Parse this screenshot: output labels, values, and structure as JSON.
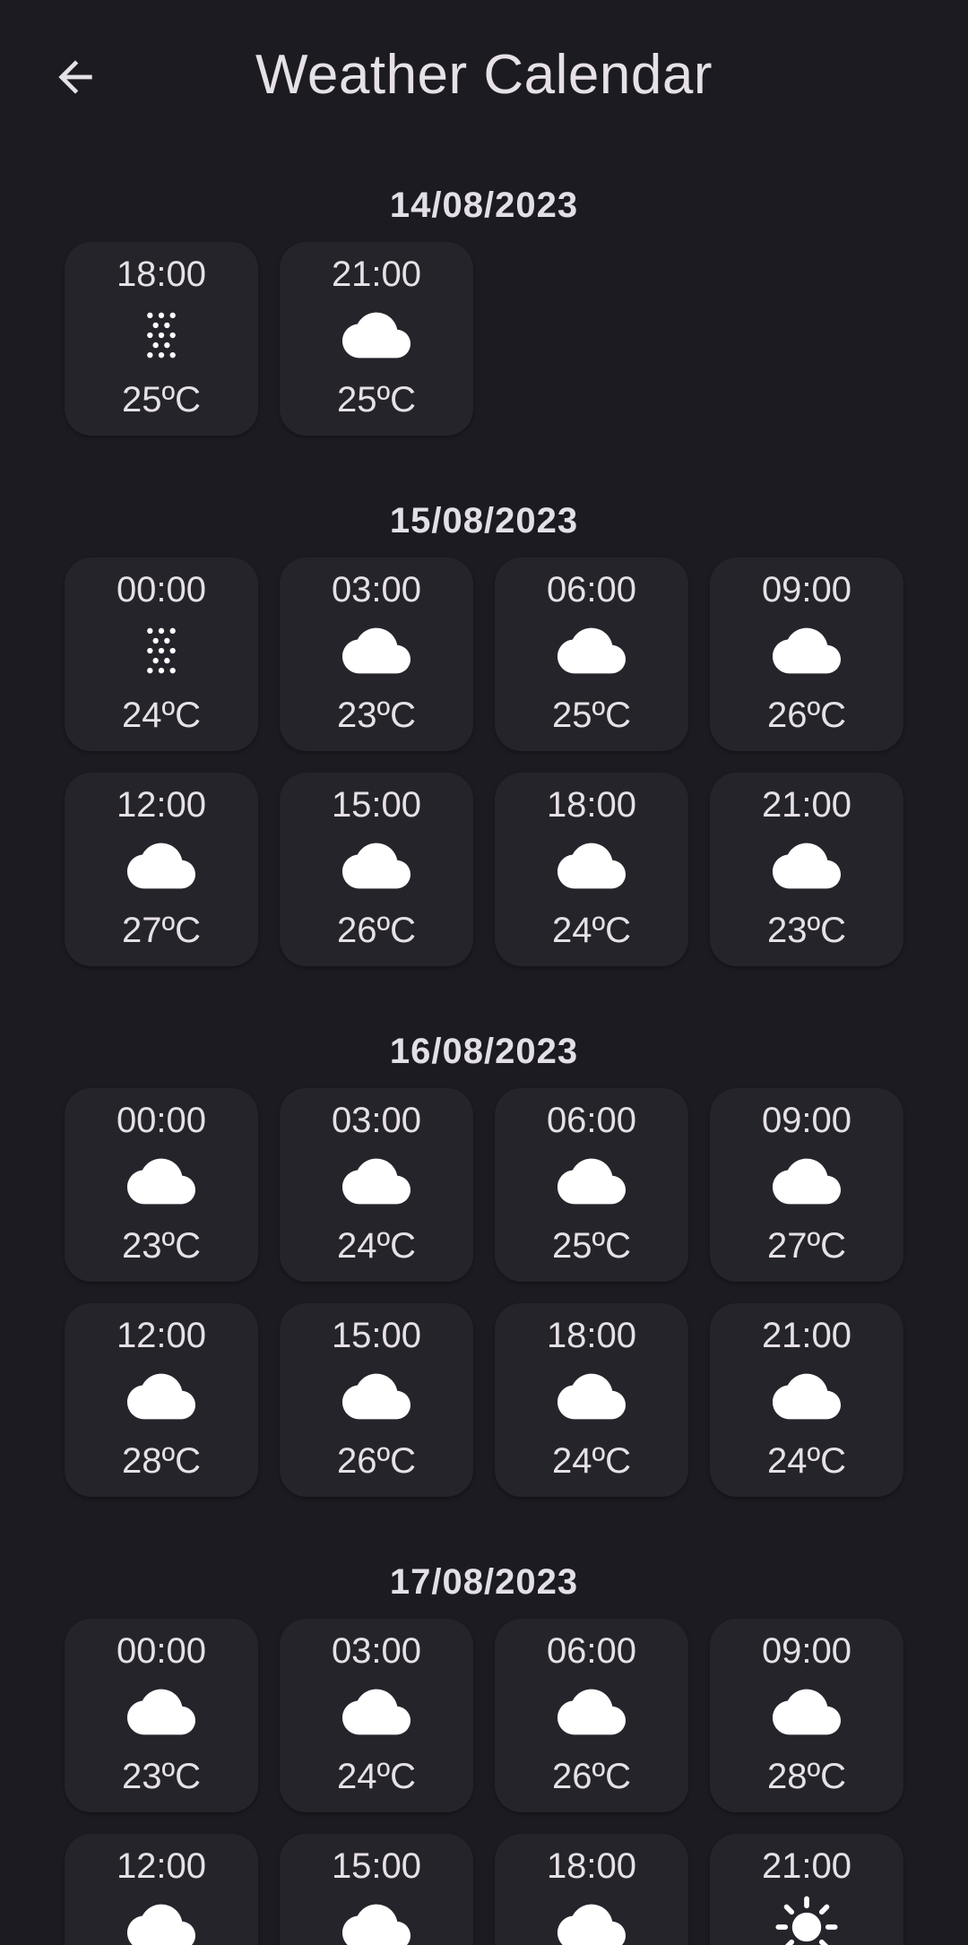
{
  "app_bar": {
    "title": "Weather Calendar",
    "back_icon": "arrow-back-icon"
  },
  "days": [
    {
      "date": "14/08/2023",
      "forecasts": [
        {
          "time": "18:00",
          "icon": "rain-dots-icon",
          "temp": "25ºC"
        },
        {
          "time": "21:00",
          "icon": "cloud-icon",
          "temp": "25ºC"
        }
      ]
    },
    {
      "date": "15/08/2023",
      "forecasts": [
        {
          "time": "00:00",
          "icon": "rain-dots-icon",
          "temp": "24ºC"
        },
        {
          "time": "03:00",
          "icon": "cloud-icon",
          "temp": "23ºC"
        },
        {
          "time": "06:00",
          "icon": "cloud-icon",
          "temp": "25ºC"
        },
        {
          "time": "09:00",
          "icon": "cloud-icon",
          "temp": "26ºC"
        },
        {
          "time": "12:00",
          "icon": "cloud-icon",
          "temp": "27ºC"
        },
        {
          "time": "15:00",
          "icon": "cloud-icon",
          "temp": "26ºC"
        },
        {
          "time": "18:00",
          "icon": "cloud-icon",
          "temp": "24ºC"
        },
        {
          "time": "21:00",
          "icon": "cloud-icon",
          "temp": "23ºC"
        }
      ]
    },
    {
      "date": "16/08/2023",
      "forecasts": [
        {
          "time": "00:00",
          "icon": "cloud-icon",
          "temp": "23ºC"
        },
        {
          "time": "03:00",
          "icon": "cloud-icon",
          "temp": "24ºC"
        },
        {
          "time": "06:00",
          "icon": "cloud-icon",
          "temp": "25ºC"
        },
        {
          "time": "09:00",
          "icon": "cloud-icon",
          "temp": "27ºC"
        },
        {
          "time": "12:00",
          "icon": "cloud-icon",
          "temp": "28ºC"
        },
        {
          "time": "15:00",
          "icon": "cloud-icon",
          "temp": "26ºC"
        },
        {
          "time": "18:00",
          "icon": "cloud-icon",
          "temp": "24ºC"
        },
        {
          "time": "21:00",
          "icon": "cloud-icon",
          "temp": "24ºC"
        }
      ]
    },
    {
      "date": "17/08/2023",
      "forecasts": [
        {
          "time": "00:00",
          "icon": "cloud-icon",
          "temp": "23ºC"
        },
        {
          "time": "03:00",
          "icon": "cloud-icon",
          "temp": "24ºC"
        },
        {
          "time": "06:00",
          "icon": "cloud-icon",
          "temp": "26ºC"
        },
        {
          "time": "09:00",
          "icon": "cloud-icon",
          "temp": "28ºC"
        },
        {
          "time": "12:00",
          "icon": "cloud-icon",
          "temp": ""
        },
        {
          "time": "15:00",
          "icon": "cloud-icon",
          "temp": ""
        },
        {
          "time": "18:00",
          "icon": "cloud-icon",
          "temp": ""
        },
        {
          "time": "21:00",
          "icon": "sun-icon",
          "temp": ""
        }
      ]
    }
  ],
  "colors": {
    "background": "#1c1b22",
    "card": "#25242b",
    "text": "#e6e1e6",
    "icon": "#ffffff"
  }
}
